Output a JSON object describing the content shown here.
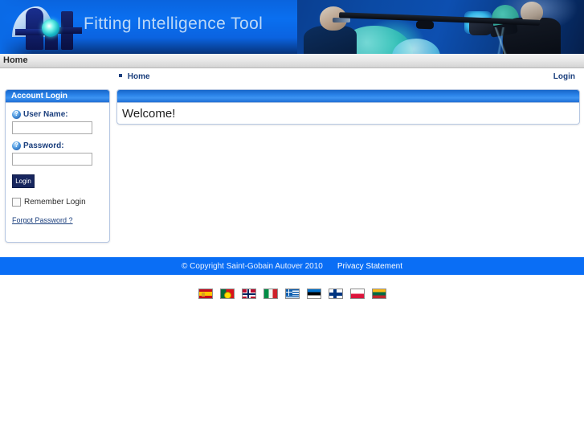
{
  "header": {
    "brand_text": "Fitting Intelligence Tool",
    "logo_alt": "fit-logo"
  },
  "nav": {
    "items": [
      {
        "label": "Home"
      }
    ]
  },
  "breadcrumb": {
    "items": [
      {
        "label": "Home"
      }
    ]
  },
  "top_right": {
    "login_label": "Login"
  },
  "login_panel": {
    "title": "Account Login",
    "username": {
      "label": "User Name:",
      "value": "",
      "placeholder": ""
    },
    "password": {
      "label": "Password:",
      "value": "",
      "placeholder": ""
    },
    "login_button": "Login",
    "remember": {
      "label": "Remember Login",
      "checked": false
    },
    "forgot_password": "Forgot Password ?"
  },
  "welcome_panel": {
    "title": "",
    "body_text": "Welcome!"
  },
  "footer": {
    "copyright": "© Copyright Saint-Gobain Autover 2010",
    "privacy_link": "Privacy Statement",
    "background_color": "#0a6ef5"
  },
  "languages": [
    {
      "name": "Spanish",
      "code": "es",
      "css": "fl-es"
    },
    {
      "name": "Portuguese",
      "code": "pt",
      "css": "fl-pt"
    },
    {
      "name": "Norwegian",
      "code": "no",
      "css": "fl-no"
    },
    {
      "name": "Italian",
      "code": "it",
      "css": "fl-it"
    },
    {
      "name": "Greek",
      "code": "gr",
      "css": "fl-gr"
    },
    {
      "name": "Estonian",
      "code": "ee",
      "css": "fl-ee"
    },
    {
      "name": "Finnish",
      "code": "fi",
      "css": "fl-fi"
    },
    {
      "name": "Polish",
      "code": "pl",
      "css": "fl-pl"
    },
    {
      "name": "Lithuanian",
      "code": "lt",
      "css": "fl-lt"
    }
  ],
  "colors": {
    "header_blue": "#0a6ff0",
    "panel_header_blue": "#2a82e8",
    "link_navy": "#1b3f7d",
    "button_navy": "#17265e",
    "footer_blue": "#0a6ef5"
  }
}
